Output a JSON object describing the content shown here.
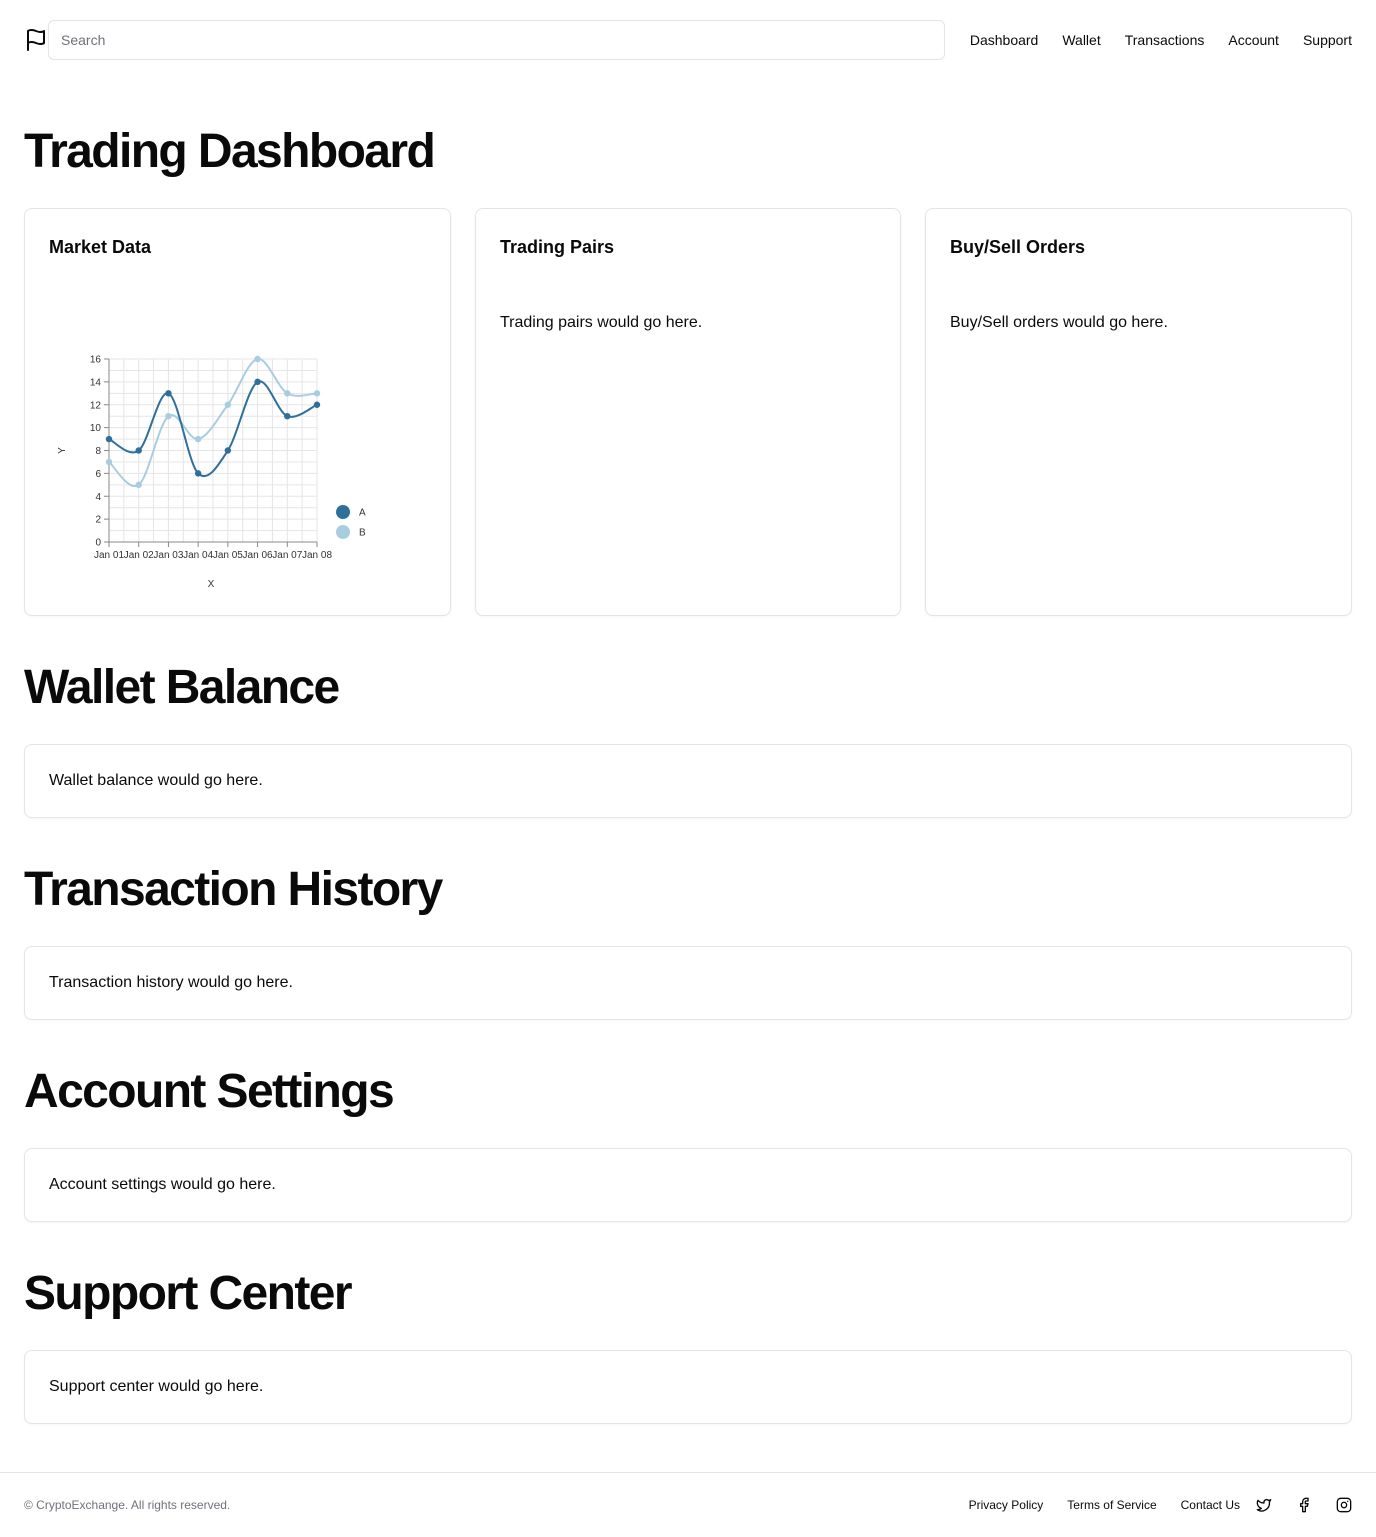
{
  "header": {
    "search_placeholder": "Search",
    "logo_icon": "flag-icon",
    "nav": [
      "Dashboard",
      "Wallet",
      "Transactions",
      "Account",
      "Support"
    ]
  },
  "sections": {
    "dashboard_title": "Trading Dashboard",
    "wallet_title": "Wallet Balance",
    "transactions_title": "Transaction History",
    "account_title": "Account Settings",
    "support_title": "Support Center"
  },
  "cards": {
    "market_title": "Market Data",
    "pairs_title": "Trading Pairs",
    "pairs_text": "Trading pairs would go here.",
    "orders_title": "Buy/Sell Orders",
    "orders_text": "Buy/Sell orders would go here.",
    "wallet_text": "Wallet balance would go here.",
    "transactions_text": "Transaction history would go here.",
    "account_text": "Account settings would go here.",
    "support_text": "Support center would go here."
  },
  "chart_data": {
    "type": "line",
    "categories": [
      "Jan 01",
      "Jan 02",
      "Jan 03",
      "Jan 04",
      "Jan 05",
      "Jan 06",
      "Jan 07",
      "Jan 08"
    ],
    "series": [
      {
        "name": "A",
        "values": [
          9,
          8,
          13,
          6,
          8,
          14,
          11,
          12
        ],
        "color": "#2f6f9b"
      },
      {
        "name": "B",
        "values": [
          7,
          5,
          11,
          9,
          12,
          16,
          13,
          13
        ],
        "color": "#a9cde0"
      }
    ],
    "xlabel": "X",
    "ylabel": "Y",
    "ylim": [
      0,
      16
    ],
    "yticks": [
      0,
      2,
      4,
      6,
      8,
      10,
      12,
      14,
      16
    ],
    "grid": true,
    "legend": "right"
  },
  "footer": {
    "copyright": "© CryptoExchange. All rights reserved.",
    "links": [
      "Privacy Policy",
      "Terms of Service",
      "Contact Us"
    ],
    "social_icons": [
      "twitter-icon",
      "facebook-icon",
      "instagram-icon"
    ]
  }
}
